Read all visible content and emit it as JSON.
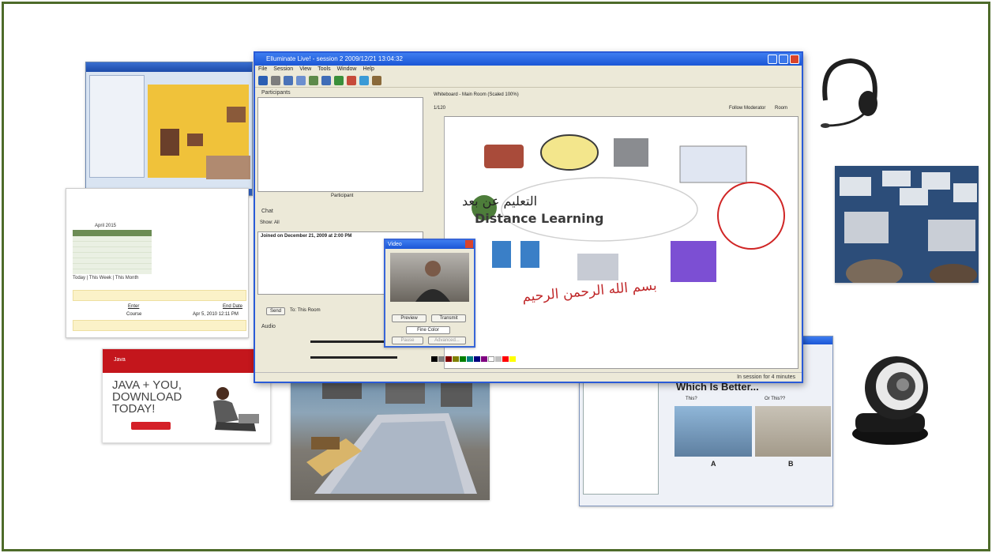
{
  "main_window": {
    "title": "Elluminate Live! - session 2 2009/12/21 13:04:32",
    "menu": [
      "File",
      "Session",
      "View",
      "Tools",
      "Window",
      "Help"
    ],
    "participants_label": "Participants",
    "participants_count_label": "Participant",
    "chat_label": "Chat",
    "chat_show_label": "Show: All",
    "chat_joined_text": "Joined on December 21, 2009 at 2:00 PM",
    "send_button": "Send",
    "to_label": "To: This Room",
    "audio_label": "Audio",
    "whiteboard_label": "Whiteboard - Main Room (Scaled 100%)",
    "page_indicator": "1/120",
    "follow_moderator_label": "Follow Moderator",
    "zoom_label": "Room",
    "status_text": "In session for 4 minutes"
  },
  "whiteboard": {
    "arabic_title": "التعليم عن بعد",
    "english_title": "Distance Learning",
    "calligraphy": "بسم الله الرحمن الرحيم"
  },
  "video_popup": {
    "title": "Video",
    "preview_button": "Preview",
    "transmit_button": "Transmit",
    "color_select": "Fine Color",
    "pause_button": "Pause",
    "advanced_button": "Advanced..."
  },
  "java_ad": {
    "line1": "JAVA + YOU,",
    "line2": "DOWNLOAD",
    "line3": "TODAY!",
    "brand": "Java"
  },
  "calendar": {
    "month": "April 2015",
    "links": "Today | This Week | This Month",
    "course_header": "Enter",
    "date_header": "End Date",
    "course_value": "Course",
    "date_value": "Apr 5, 2010 12:11 PM"
  },
  "bottom_right": {
    "heading": "Which Is Better...",
    "label_this": "This?",
    "label_or_this": "Or This??",
    "label_a": "A",
    "label_b": "B"
  },
  "colors": {
    "frame": "#4e6b2a",
    "xp_blue": "#1b56d6",
    "java_red": "#c4161c"
  }
}
